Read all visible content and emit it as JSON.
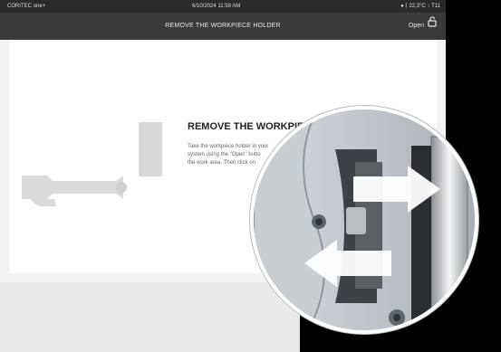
{
  "status_bar": {
    "brand": "CORITEC one+",
    "datetime": "6/10/2024 11:58 AM",
    "temperature": "22,3°C",
    "status_right": "T11"
  },
  "title_bar": {
    "title": "REMOVE THE WORKPIECE HOLDER",
    "open_label": "Open"
  },
  "content": {
    "heading": "REMOVE THE WORKPIECE",
    "instruction_lines": [
      "Take the workpiece holder in your",
      "system using the \"Open\" butto",
      "the work area. Then click on"
    ]
  },
  "colors": {
    "status_bg": "#2a2a2a",
    "titlebar_bg": "#3b3b3b",
    "arrow": "#ffffff"
  },
  "icons": {
    "open": "unlock-icon",
    "globe": "globe-icon",
    "temperature": "thermometer-icon",
    "status": "pin-icon"
  }
}
